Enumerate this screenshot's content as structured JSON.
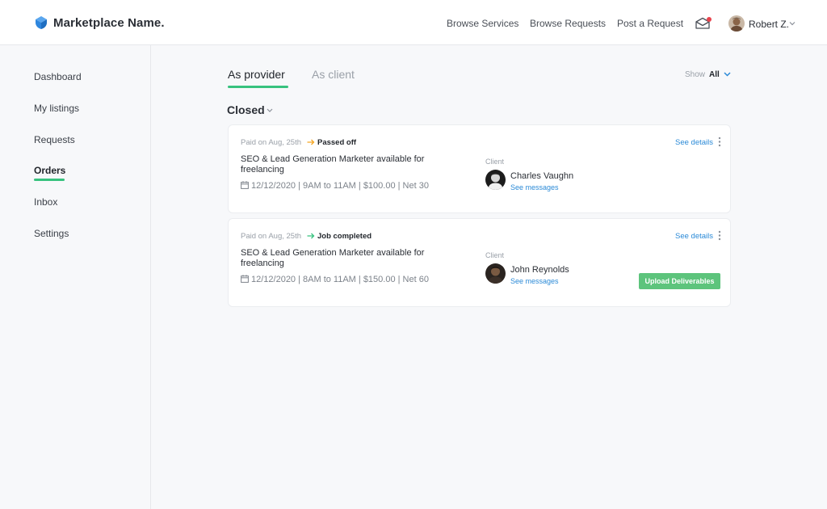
{
  "header": {
    "brand": "Marketplace Name.",
    "nav": {
      "browse_services": "Browse Services",
      "browse_requests": "Browse Requests",
      "post_request": "Post a Request"
    },
    "user_name": "Robert Z.",
    "icons": {
      "logo": "logo-icon",
      "inbox": "envelope-icon",
      "chevron": "chevron-down-icon"
    }
  },
  "sidebar": {
    "items": [
      {
        "label": "Dashboard"
      },
      {
        "label": "My listings"
      },
      {
        "label": "Requests"
      },
      {
        "label": "Orders",
        "active": true
      },
      {
        "label": "Inbox"
      },
      {
        "label": "Settings"
      }
    ]
  },
  "tabs": {
    "provider": "As provider",
    "client": "As client",
    "active": "provider"
  },
  "show": {
    "label": "Show",
    "value": "All"
  },
  "filter": {
    "label": "Closed"
  },
  "orders": [
    {
      "paid": "Paid on Aug, 25th",
      "status": "Passed off",
      "status_color": "#f5a623",
      "title": "SEO & Lead Generation Marketer available for freelancing",
      "meta": "12/12/2020 | 9AM to 11AM | $100.00 | Net 30",
      "client_label": "Client",
      "client_name": "Charles Vaughn",
      "see_messages": "See messages",
      "see_details": "See details"
    },
    {
      "paid": "Paid on Aug, 25th",
      "status": "Job completed",
      "status_color": "#37c27e",
      "title": "SEO & Lead Generation Marketer available for freelancing",
      "meta": "12/12/2020 | 8AM to 11AM | $150.00 | Net 60",
      "client_label": "Client",
      "client_name": "John Reynolds",
      "see_messages": "See messages",
      "see_details": "See details",
      "action": "Upload Deliverables"
    }
  ],
  "colors": {
    "accent": "#37c27e",
    "link": "#2b8ad7",
    "button": "#5dc47c",
    "notification": "#e8434d",
    "logo": "#2e86de"
  }
}
